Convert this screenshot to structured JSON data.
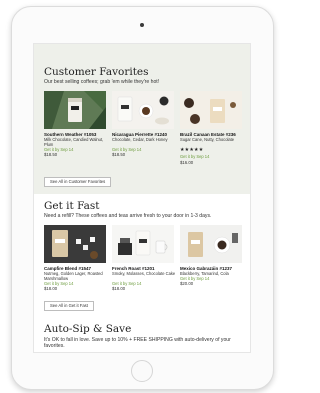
{
  "favorites": {
    "title": "Customer Favorites",
    "subtitle": "Our best selling coffees; grab 'em while they're hot!",
    "see_all": "See All in Customer Favorites",
    "products": [
      {
        "name": "Southern Weather #1053",
        "desc": "Milk Chocolate, Candied Walnut, Plum",
        "ship": "Get it by Sep 14",
        "price": "$18.50"
      },
      {
        "name": "Nicaragua Pierrette #1240",
        "desc": "Chocolate, Cedar, Dark Honey",
        "ship": "Get it by Sep 14",
        "price": "$18.50"
      },
      {
        "name": "Brazil Canaan Estate #236",
        "desc": "Sugar Cane, Nutty, Chocolate",
        "stars": "★★★★★",
        "ship": "Get it by Sep 14",
        "price": "$16.00"
      }
    ]
  },
  "fast": {
    "title": "Get it Fast",
    "subtitle": "Need a refill? These coffees and teas arrive fresh to your door in 1-3 days.",
    "see_all": "See All in Get it Fast",
    "products": [
      {
        "name": "Campfire Blend #1547",
        "desc": "Nutmeg, Golden Lager, Roasted Marshmallow",
        "ship": "Get it by Sep 14",
        "price": "$18.00"
      },
      {
        "name": "French Roast #1201",
        "desc": "Smoky, Molasses, Chocolate Cake",
        "ship": "Get it by Sep 14",
        "price": "$18.00"
      },
      {
        "name": "Mexico Gabrazáin #1237",
        "desc": "Blackberry, Tamarind, Cola",
        "ship": "Get it by Sep 14",
        "price": "$20.00"
      }
    ]
  },
  "autoship": {
    "title": "Auto-Sip & Save",
    "subtitle": "It's OK to fall in love. Save up to 10% + FREE SHIPPING with auto-delivery of your favorites."
  },
  "colors": {
    "favorites_bg": "#eef0ea",
    "ship_green": "#6a9a3a"
  }
}
